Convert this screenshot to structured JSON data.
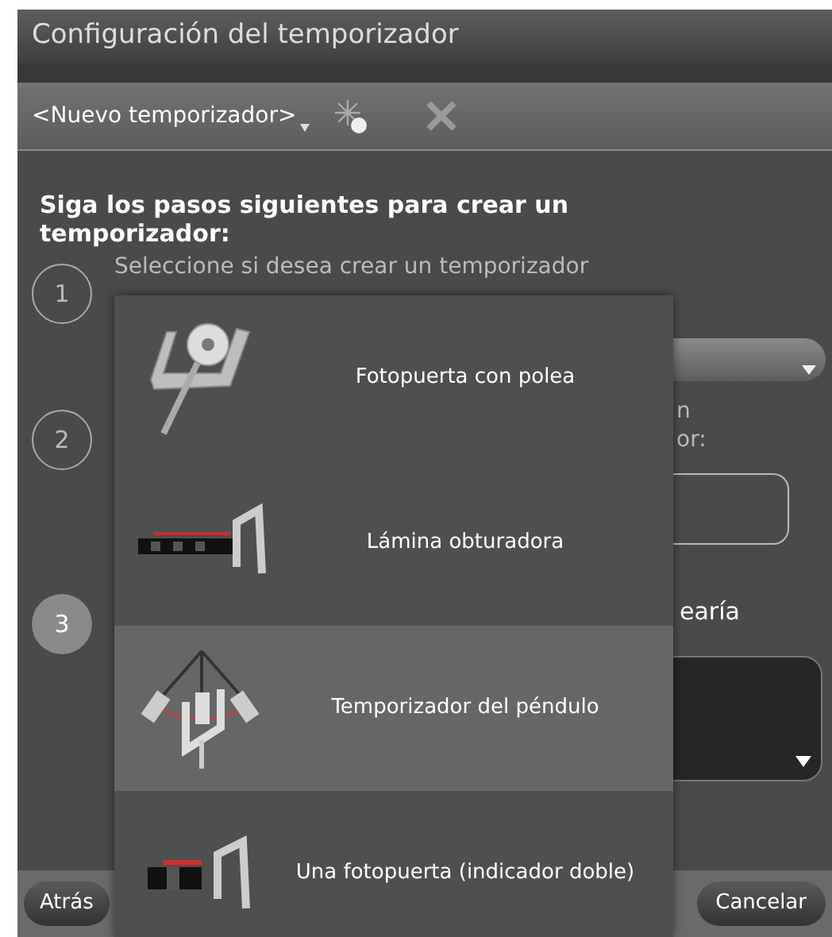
{
  "window": {
    "title": "Configuración del temporizador"
  },
  "toolbar": {
    "timer_name": "<Nuevo temporizador>"
  },
  "instructions": "Siga los pasos siguientes para crear un temporizador:",
  "steps": [
    {
      "number": "1",
      "text": "Seleccione si desea crear un temporizador",
      "selected": false
    },
    {
      "number": "2",
      "text_lines": [
        "n",
        "or:"
      ],
      "selected": false
    },
    {
      "number": "3",
      "text_lines": [
        "earía"
      ],
      "selected": true
    }
  ],
  "menu": [
    {
      "kind": "pulley",
      "label": "Fotopuerta con polea",
      "selected": false
    },
    {
      "kind": "shutter",
      "label": "Lámina obturadora",
      "selected": false
    },
    {
      "kind": "pendulum",
      "label": "Temporizador del péndulo",
      "selected": true
    },
    {
      "kind": "gate",
      "label": "Una fotopuerta (indicador doble)",
      "selected": false
    }
  ],
  "buttons": {
    "back": "Atrás",
    "cancel": "Cancelar"
  }
}
